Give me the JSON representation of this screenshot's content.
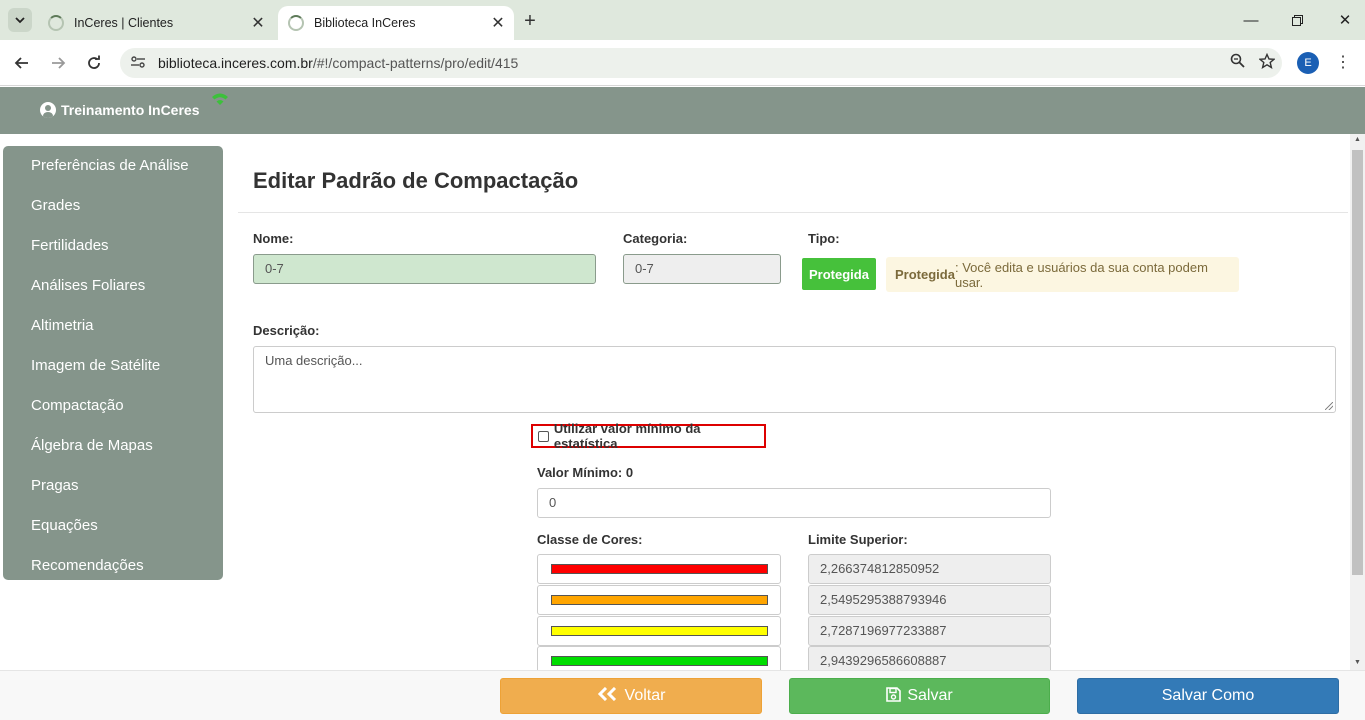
{
  "browser": {
    "tabs": [
      {
        "title": "InCeres | Clientes"
      },
      {
        "title": "Biblioteca InCeres"
      }
    ],
    "url_host": "biblioteca.inceres.com.br",
    "url_path": "/#!/compact-patterns/pro/edit/415",
    "profile_initial": "E"
  },
  "header": {
    "user": "Treinamento InCeres",
    "wifi_color": "#3cc13b",
    "bg_color": "#85958b"
  },
  "sidebar": {
    "items": [
      {
        "label": "Preferências de Análise"
      },
      {
        "label": "Grades"
      },
      {
        "label": "Fertilidades"
      },
      {
        "label": "Análises Foliares"
      },
      {
        "label": "Altimetria"
      },
      {
        "label": "Imagem de Satélite"
      },
      {
        "label": "Compactação"
      },
      {
        "label": "Álgebra de Mapas"
      },
      {
        "label": "Pragas"
      },
      {
        "label": "Equações"
      },
      {
        "label": "Recomendações"
      }
    ]
  },
  "form": {
    "title": "Editar Padrão de Compactação",
    "nome_label": "Nome:",
    "nome_value": "0-7",
    "categoria_label": "Categoria:",
    "categoria_value": "0-7",
    "tipo_label": "Tipo:",
    "tipo_badge": "Protegida",
    "tipo_note_bold": "Protegida",
    "tipo_note_text": ": Você edita e usuários da sua conta podem usar.",
    "descricao_label": "Descrição:",
    "descricao_placeholder": "Uma descrição...",
    "checkbox_label": "Utilizar valor mínimo da estatística",
    "checkbox_checked": false,
    "valor_minimo_label": "Valor Mínimo: 0",
    "valor_minimo_value": "0",
    "classe_cores_label": "Classe de Cores:",
    "limite_superior_label": "Limite Superior:",
    "classes": [
      {
        "color": "#ff0000",
        "limit": "2,266374812850952"
      },
      {
        "color": "#ffa500",
        "limit": "2,5495295388793946"
      },
      {
        "color": "#ffff00",
        "limit": "2,7287196977233887"
      },
      {
        "color": "#00dd00",
        "limit": "2,9439296586608887"
      }
    ]
  },
  "footer": {
    "voltar_label": "Voltar",
    "salvar_label": "Salvar",
    "salvar_como_label": "Salvar Como"
  }
}
